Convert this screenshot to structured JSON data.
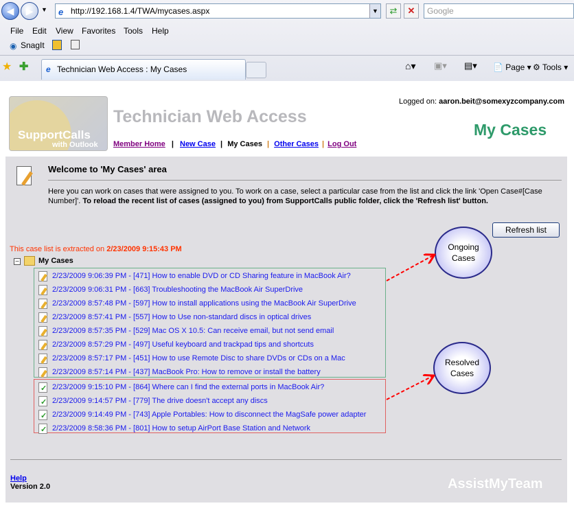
{
  "browser": {
    "url": "http://192.168.1.4/TWA/mycases.aspx",
    "search_placeholder": "Google",
    "menu": [
      "File",
      "Edit",
      "View",
      "Favorites",
      "Tools",
      "Help"
    ],
    "toolbar_snagit": "SnagIt",
    "tab_title": "Technician Web Access : My Cases",
    "page_label": "Page",
    "tools_label": "Tools"
  },
  "header": {
    "logo_text": "SupportCalls",
    "logo_sub": "with Outlook",
    "app_title": "Technician Web Access",
    "logged_label": "Logged on:",
    "logged_user": "aaron.beit@somexyzcompany.com",
    "page_title": "My Cases",
    "nav": [
      {
        "label": "Member Home",
        "color": "#800080"
      },
      {
        "label": "New Case",
        "color": "#0000ee"
      },
      {
        "label": "My Cases",
        "color": "#000000"
      },
      {
        "label": "Other Cases",
        "color": "#0000ee"
      },
      {
        "label": "Log Out",
        "color": "#800080"
      }
    ]
  },
  "welcome": {
    "heading": "Welcome to 'My Cases' area",
    "text": "Here you can work on cases that were assigned to you. To work on a case, select a particular case from the list and click the link 'Open Case#[Case Number]'.",
    "text_bold": " To reload the recent list of cases (assigned to you) from SupportCalls public folder, click the 'Refresh list' button."
  },
  "refresh_label": "Refresh list",
  "extract_label": "This case list is extracted on",
  "extract_time": "2/23/2009 9:15:43 PM",
  "tree_root": "My Cases",
  "ongoing_label": "Ongoing Cases",
  "resolved_label": "Resolved Cases",
  "ongoing_cases": [
    "2/23/2009 9:06:39 PM - [471] How to enable DVD or CD Sharing feature in MacBook Air?",
    "2/23/2009 9:06:31 PM - [663] Troubleshooting the MacBook Air SuperDrive",
    "2/23/2009 8:57:48 PM - [597] How to install applications using the MacBook Air SuperDrive",
    "2/23/2009 8:57:41 PM - [557] How to Use non-standard discs in optical drives",
    "2/23/2009 8:57:35 PM - [529] Mac OS X 10.5: Can receive email, but not send email",
    "2/23/2009 8:57:29 PM - [497] Useful keyboard and trackpad tips and shortcuts",
    "2/23/2009 8:57:17 PM - [451] How to use Remote Disc to share DVDs or CDs on a Mac",
    "2/23/2009 8:57:14 PM - [437] MacBook Pro: How to remove or install the battery"
  ],
  "resolved_cases": [
    "2/23/2009 9:15:10 PM - [864] Where can I find the external ports in MacBook Air?",
    "2/23/2009 9:14:57 PM - [779] The drive doesn't accept any discs",
    "2/23/2009 9:14:49 PM - [743] Apple Portables: How to disconnect the MagSafe power adapter",
    "2/23/2009 8:58:36 PM - [801] How to setup AirPort Base Station and Network"
  ],
  "footer": {
    "help": "Help",
    "version": "Version 2.0",
    "brand": "AssistMyTeam"
  }
}
